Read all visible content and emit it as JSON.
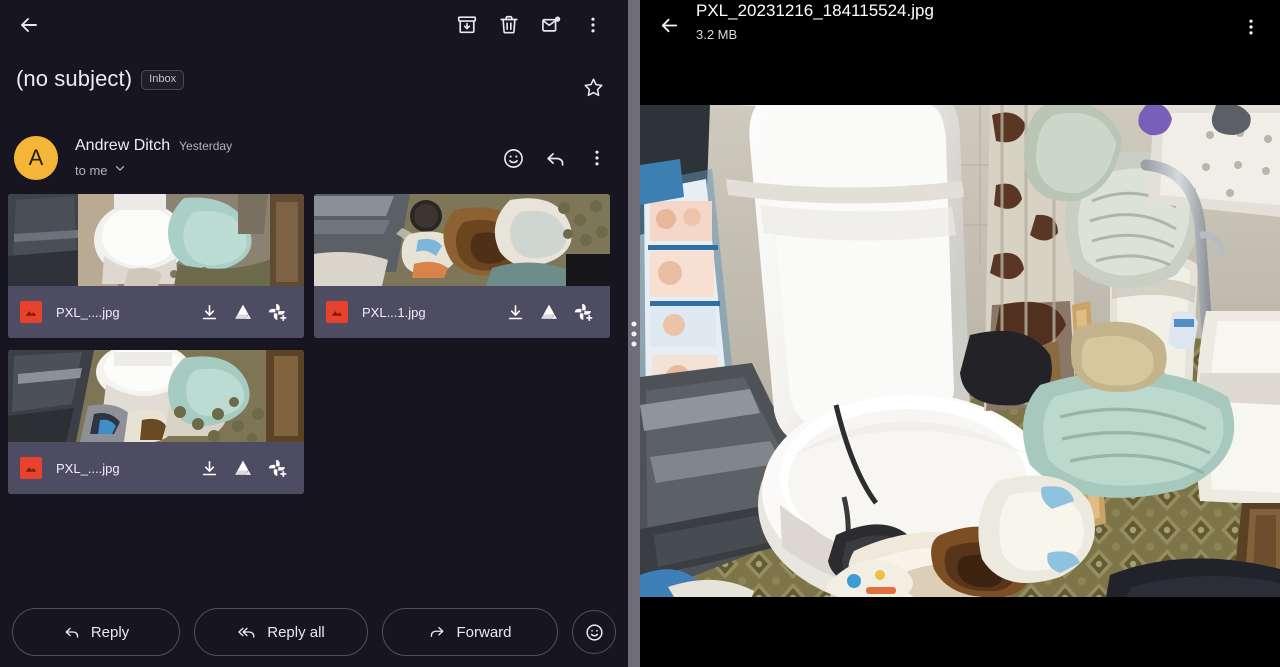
{
  "mail": {
    "toolbar": {
      "back": "back-arrow",
      "archive": "archive-icon",
      "delete": "trash-icon",
      "mark_unread": "mark-unread-icon",
      "more": "more-vert-icon"
    },
    "subject": "(no subject)",
    "label_chip": "Inbox",
    "starred": false,
    "sender": {
      "avatar_letter": "A",
      "avatar_color": "#f5b638",
      "name": "Andrew Ditch",
      "time": "Yesterday",
      "recipients": "to me"
    },
    "attachments": [
      {
        "name": "PXL_....jpg",
        "type": "image"
      },
      {
        "name": "PXL...1.jpg",
        "type": "image"
      },
      {
        "name": "PXL_....jpg",
        "type": "image"
      }
    ],
    "attachment_actions": {
      "download": "download-icon",
      "drive": "google-drive-icon",
      "photos": "google-photos-add-icon"
    },
    "actions": {
      "reply": "Reply",
      "reply_all": "Reply all",
      "forward": "Forward",
      "emoji": "emoji-react-icon"
    }
  },
  "viewer": {
    "back": "back-arrow",
    "title": "PXL_20231216_184115524.jpg",
    "size": "3.2 MB",
    "more": "more-vert-icon"
  },
  "colors": {
    "mail_background": "#17151f",
    "attachment_chip": "#4e4c63",
    "accent_avatar": "#f5b638",
    "file_icon": "#e8412c",
    "divider": "#6e6e78",
    "viewer_background": "#000000"
  }
}
